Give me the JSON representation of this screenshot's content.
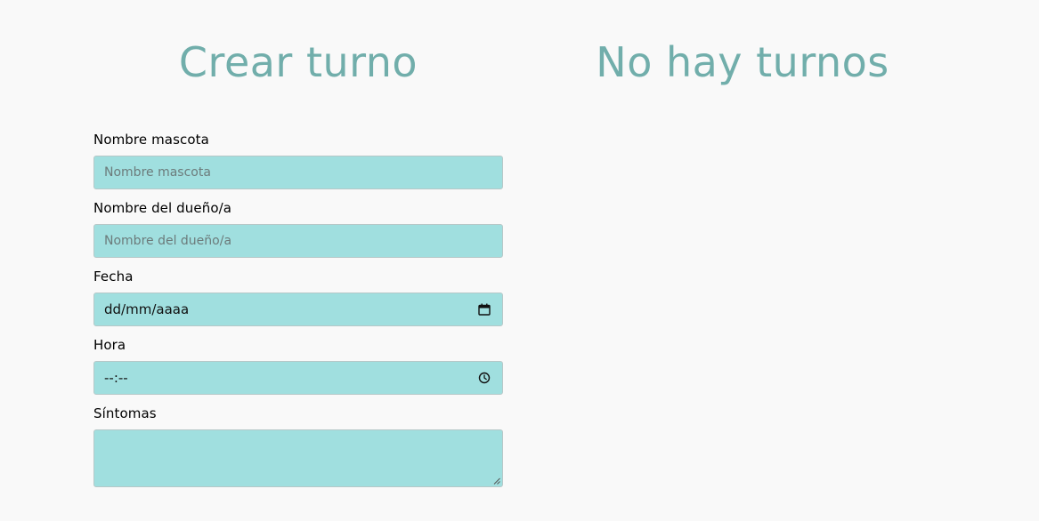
{
  "left": {
    "title": "Crear turno",
    "form": {
      "pet_name": {
        "label": "Nombre mascota",
        "placeholder": "Nombre mascota"
      },
      "owner_name": {
        "label": "Nombre del dueño/a",
        "placeholder": "Nombre del dueño/a"
      },
      "date": {
        "label": "Fecha",
        "value": "dd/mm/aaaa",
        "icon": "calendar-icon"
      },
      "time": {
        "label": "Hora",
        "value": "--:--",
        "icon": "clock-icon"
      },
      "symptoms": {
        "label": "Síntomas",
        "value": ""
      }
    }
  },
  "right": {
    "title": "No hay turnos"
  },
  "colors": {
    "background": "#f9f9f9",
    "heading": "#71aeab",
    "input_bg": "#a0dfdf",
    "input_border": "#b6c8c8"
  }
}
